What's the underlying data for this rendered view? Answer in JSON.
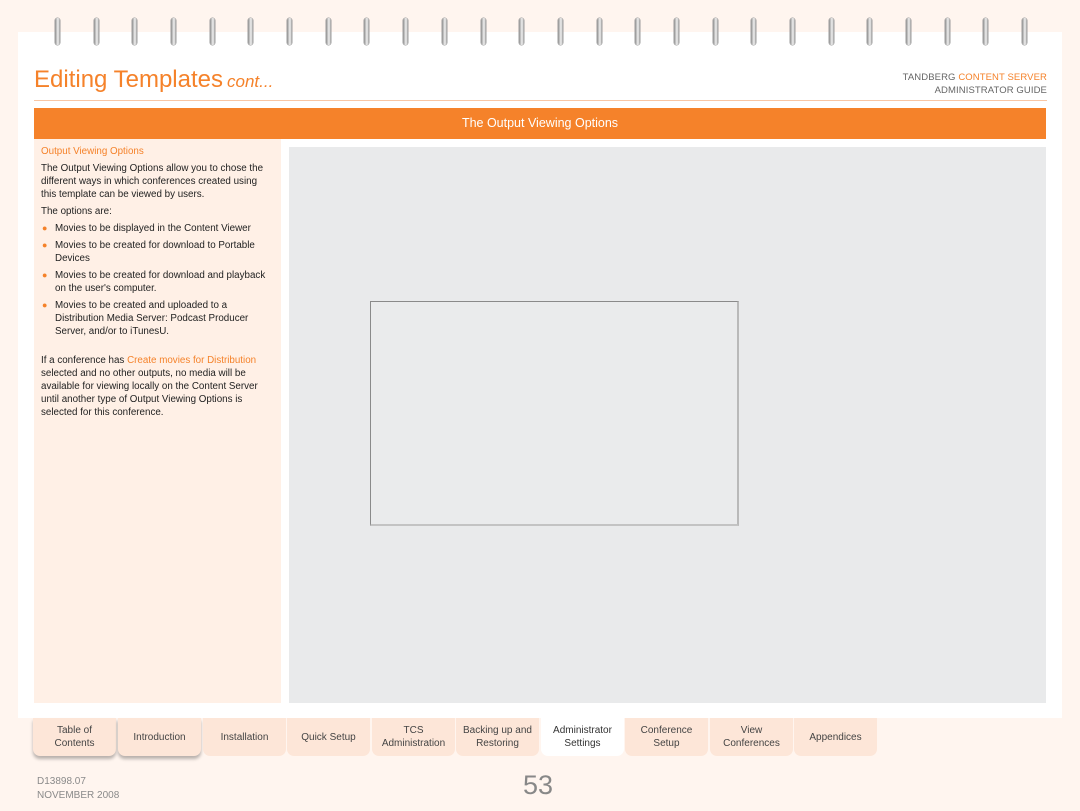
{
  "header": {
    "title": "Editing Templates",
    "title_suffix": "cont...",
    "brand_name": "TANDBERG",
    "brand_product": "CONTENT SERVER",
    "guide_title": "ADMINISTRATOR GUIDE"
  },
  "section_bar": {
    "title": "The Output Viewing Options"
  },
  "sidebar": {
    "heading": "Output Viewing Options",
    "intro": "The Output Viewing Options allow you to chose the different ways in which conferences created using this template can be viewed by users.",
    "options_lead": "The options are:",
    "options": [
      "Movies to be displayed in the Content Viewer",
      "Movies to be created for download to Portable Devices",
      "Movies to be created for download and playback on the user's computer.",
      "Movies to be created and uploaded to a Distribution Media Server: Podcast Producer Server, and/or to iTunesU."
    ],
    "note_before_link": "If a conference has ",
    "note_link": "Create movies for Distribution",
    "note_after_link": " selected and no other outputs, no media will be available for viewing locally on the Content Server until another type of Output Viewing Options is selected for this conference."
  },
  "tabs": [
    {
      "label": "Table of\nContents",
      "active": false
    },
    {
      "label": "Introduction",
      "active": false
    },
    {
      "label": "Installation",
      "active": false
    },
    {
      "label": "Quick Setup",
      "active": false
    },
    {
      "label": "TCS\nAdministration",
      "active": false
    },
    {
      "label": "Backing up and\nRestoring",
      "active": false
    },
    {
      "label": "Administrator\nSettings",
      "active": true
    },
    {
      "label": "Conference\nSetup",
      "active": false
    },
    {
      "label": "View\nConferences",
      "active": false
    },
    {
      "label": "Appendices",
      "active": false
    }
  ],
  "footer": {
    "doc_id": "D13898.07",
    "date": "NOVEMBER 2008",
    "page_number": "53"
  },
  "colors": {
    "accent": "#f5822a",
    "page_background": "#fff5ef",
    "sidebar_background": "#fff0e6",
    "screenshot_background": "#e9eaeb"
  }
}
